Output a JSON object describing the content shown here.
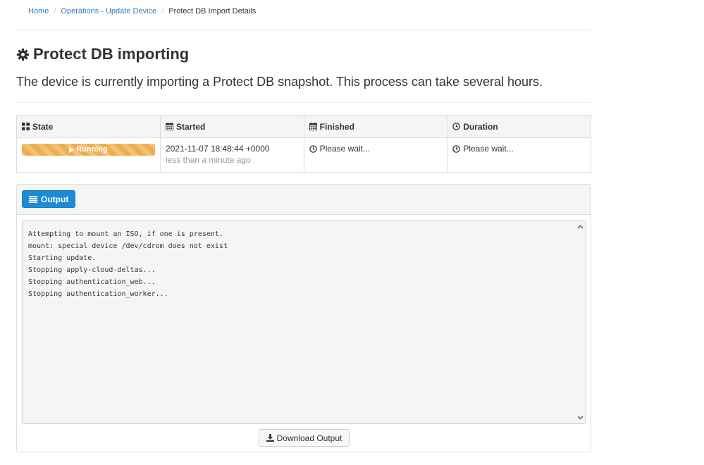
{
  "breadcrumb": {
    "home": "Home",
    "operations": "Operations - Update Device",
    "current": "Protect DB Import Details"
  },
  "page": {
    "title": "Protect DB importing",
    "lead": "The device is currently importing a Protect DB snapshot. This process can take several hours."
  },
  "table": {
    "headers": {
      "state": "State",
      "started": "Started",
      "finished": "Finished",
      "duration": "Duration"
    },
    "row": {
      "state_label": "Running",
      "state_progress": 1.0,
      "started": "2021-11-07 18:48:44 +0000",
      "started_relative": "less than a minute ago",
      "finished": "Please wait...",
      "duration": "Please wait..."
    }
  },
  "output": {
    "button_label": "Output",
    "lines": [
      "Attempting to mount an ISO, if one is present.",
      "mount: special device /dev/cdrom does not exist",
      "Starting update.",
      "Stopping apply-cloud-deltas...",
      "Stopping authentication_web...",
      "Stopping authentication_worker..."
    ],
    "download_label": "Download Output"
  },
  "colors": {
    "link": "#337ab7",
    "warning": "#f0ad4e",
    "primary": "#1a8cd8"
  },
  "icons": {
    "title": "gear-icon",
    "state": "th-large-icon",
    "started": "calendar-icon",
    "finished": "calendar-icon",
    "duration": "clock-icon",
    "running": "play-icon",
    "output": "list-icon",
    "download": "download-icon"
  }
}
